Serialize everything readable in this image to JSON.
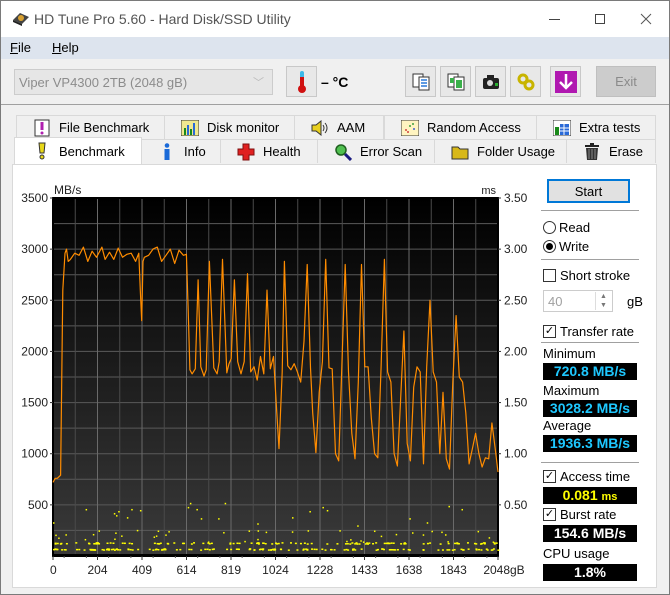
{
  "window": {
    "title": "HD Tune Pro 5.60 - Hard Disk/SSD Utility",
    "controls": {
      "minimize": "—",
      "maximize": "☐",
      "close": "✕"
    }
  },
  "menu": [
    {
      "label": "File",
      "accel": "F",
      "rest": "ile"
    },
    {
      "label": "Help",
      "accel": "H",
      "rest": "elp"
    }
  ],
  "toolbar": {
    "drive": "Viper VP4300 2TB (2048 gB)",
    "temperature": "– °C",
    "buttons": [
      "copy-text-icon",
      "copy-screenshot-icon",
      "camera-icon",
      "options-icon",
      "save-download-icon"
    ],
    "exit_label": "Exit"
  },
  "tabs_top": [
    {
      "label": "File Benchmark",
      "icon": "file-benchmark-icon"
    },
    {
      "label": "Disk monitor",
      "icon": "disk-monitor-icon"
    },
    {
      "label": "AAM",
      "icon": "speaker-icon"
    },
    {
      "label": "Random Access",
      "icon": "random-access-icon"
    },
    {
      "label": "Extra tests",
      "icon": "extra-tests-icon"
    }
  ],
  "tabs_bottom": [
    {
      "label": "Benchmark",
      "icon": "exclamation-icon",
      "active": true
    },
    {
      "label": "Info",
      "icon": "info-icon"
    },
    {
      "label": "Health",
      "icon": "health-cross-icon"
    },
    {
      "label": "Error Scan",
      "icon": "magnifier-icon"
    },
    {
      "label": "Folder Usage",
      "icon": "folder-icon"
    },
    {
      "label": "Erase",
      "icon": "trash-icon"
    }
  ],
  "controls": {
    "start_label": "Start",
    "read_label": "Read",
    "write_label": "Write",
    "mode_selected": "Write",
    "short_stroke_label": "Short stroke",
    "short_stroke_checked": false,
    "short_stroke_value": "40",
    "short_stroke_unit": "gB",
    "transfer_rate_label": "Transfer rate",
    "transfer_rate_checked": true,
    "access_time_label": "Access time",
    "access_time_checked": true,
    "burst_rate_label": "Burst rate",
    "burst_rate_checked": true
  },
  "stats": {
    "minimum_label": "Minimum",
    "minimum": "720.8 MB/s",
    "maximum_label": "Maximum",
    "maximum": "3028.2 MB/s",
    "average_label": "Average",
    "average": "1936.3 MB/s",
    "access_time_value": "0.081",
    "access_time_unit": "ms",
    "burst_rate": "154.6 MB/s",
    "cpu_label": "CPU usage",
    "cpu": "1.8%"
  },
  "colors": {
    "transfer_line": "#ff8c00",
    "access_points": "#ffff00",
    "stat_cyan": "#1ec8ff",
    "focus_blue": "#0078d7"
  },
  "chart_data": {
    "type": "line",
    "title": "",
    "xlabel": "gB",
    "ylabel_left": "MB/s",
    "ylabel_right": "ms",
    "xlim": [
      0,
      2048
    ],
    "ylim_left": [
      0,
      3500
    ],
    "ylim_right": [
      0,
      3.5
    ],
    "x_ticks": [
      "0",
      "204",
      "409",
      "614",
      "819",
      "1024",
      "1228",
      "1433",
      "1638",
      "1843",
      "2048gB"
    ],
    "y_ticks_left": [
      "3500",
      "3000",
      "2500",
      "2000",
      "1500",
      "1000",
      "500"
    ],
    "y_ticks_right": [
      "3.50",
      "3.00",
      "2.50",
      "2.00",
      "1.50",
      "1.00",
      "0.50"
    ],
    "grid": true,
    "series": [
      {
        "name": "Transfer rate (MB/s)",
        "x": [
          0,
          10,
          20,
          35,
          45,
          55,
          62,
          70,
          80,
          100,
          120,
          140,
          160,
          180,
          200,
          225,
          240,
          260,
          280,
          300,
          320,
          340,
          360,
          380,
          395,
          402,
          408,
          414,
          420,
          440,
          460,
          480,
          500,
          520,
          540,
          560,
          580,
          600,
          614,
          622,
          630,
          640,
          655,
          668,
          680,
          695,
          705,
          720,
          740,
          755,
          765,
          780,
          800,
          810,
          820,
          835,
          850,
          865,
          880,
          895,
          910,
          925,
          940,
          955,
          970,
          985,
          1000,
          1015,
          1030,
          1040,
          1055,
          1065,
          1080,
          1095,
          1110,
          1125,
          1140,
          1155,
          1170,
          1185,
          1195,
          1210,
          1225,
          1240,
          1255,
          1270,
          1285,
          1300,
          1315,
          1330,
          1345,
          1360,
          1375,
          1390,
          1405,
          1420,
          1435,
          1450,
          1465,
          1480,
          1495,
          1510,
          1525,
          1540,
          1555,
          1570,
          1585,
          1600,
          1615,
          1630,
          1645,
          1660,
          1675,
          1690,
          1705,
          1720,
          1735,
          1750,
          1765,
          1780,
          1795,
          1810,
          1825,
          1840,
          1855,
          1870,
          1885,
          1900,
          1915,
          1930,
          1945,
          1960,
          1975,
          1990,
          2005,
          2020,
          2035,
          2048
        ],
        "values": [
          720,
          760,
          760,
          790,
          2600,
          2960,
          3000,
          2880,
          2900,
          2960,
          2940,
          3020,
          2880,
          2980,
          2920,
          3020,
          2900,
          2970,
          2900,
          3010,
          2920,
          2950,
          2960,
          2880,
          2960,
          2600,
          2300,
          2880,
          2920,
          2940,
          3000,
          3020,
          2880,
          2940,
          3000,
          2860,
          2990,
          2940,
          2950,
          2400,
          1820,
          1780,
          1830,
          2700,
          1850,
          1760,
          1820,
          2880,
          1840,
          1780,
          1900,
          2900,
          1790,
          1880,
          1930,
          2700,
          1900,
          1780,
          1900,
          2760,
          1800,
          1850,
          1720,
          1950,
          1780,
          2600,
          1830,
          1950,
          1400,
          1050,
          1800,
          2880,
          1860,
          1820,
          1880,
          1800,
          1700,
          2100,
          2850,
          1840,
          1400,
          1010,
          1600,
          1900,
          2900,
          1840,
          1830,
          1000,
          930,
          1900,
          2850,
          1800,
          1200,
          950,
          1700,
          2850,
          1850,
          1850,
          1350,
          1000,
          960,
          1850,
          2900,
          1800,
          1700,
          1000,
          880,
          1550,
          2200,
          1100,
          930,
          1650,
          1850,
          1800,
          900,
          1850,
          2500,
          1800,
          1700,
          1000,
          1600,
          950,
          850,
          1700,
          2350,
          1750,
          1700,
          1400,
          900,
          1050,
          1200,
          1000,
          870,
          960,
          950,
          1300,
          1050,
          820,
          950,
          1020,
          1000,
          880,
          840,
          820
        ]
      },
      {
        "name": "Access time (ms)",
        "style": "scatter",
        "description": "Mostly 0.07–0.13 ms band with sparse outliers up to ~0.52 ms",
        "typical_band_ms": [
          0.07,
          0.13
        ],
        "outlier_points": [
          {
            "x": 0,
            "y": 0.33
          },
          {
            "x": 150,
            "y": 0.46
          },
          {
            "x": 280,
            "y": 0.42
          },
          {
            "x": 290,
            "y": 0.4
          },
          {
            "x": 300,
            "y": 0.44
          },
          {
            "x": 340,
            "y": 0.38
          },
          {
            "x": 360,
            "y": 0.46
          },
          {
            "x": 400,
            "y": 0.45
          },
          {
            "x": 620,
            "y": 0.48
          },
          {
            "x": 630,
            "y": 0.52
          },
          {
            "x": 660,
            "y": 0.46
          },
          {
            "x": 680,
            "y": 0.37
          },
          {
            "x": 760,
            "y": 0.37
          },
          {
            "x": 790,
            "y": 0.52
          },
          {
            "x": 900,
            "y": 0.25
          },
          {
            "x": 940,
            "y": 0.32
          },
          {
            "x": 1100,
            "y": 0.38
          },
          {
            "x": 1180,
            "y": 0.44
          },
          {
            "x": 1240,
            "y": 0.48
          },
          {
            "x": 1260,
            "y": 0.45
          },
          {
            "x": 1400,
            "y": 0.3
          },
          {
            "x": 1640,
            "y": 0.37
          },
          {
            "x": 1720,
            "y": 0.33
          },
          {
            "x": 1820,
            "y": 0.49
          },
          {
            "x": 1880,
            "y": 0.46
          }
        ]
      }
    ]
  }
}
